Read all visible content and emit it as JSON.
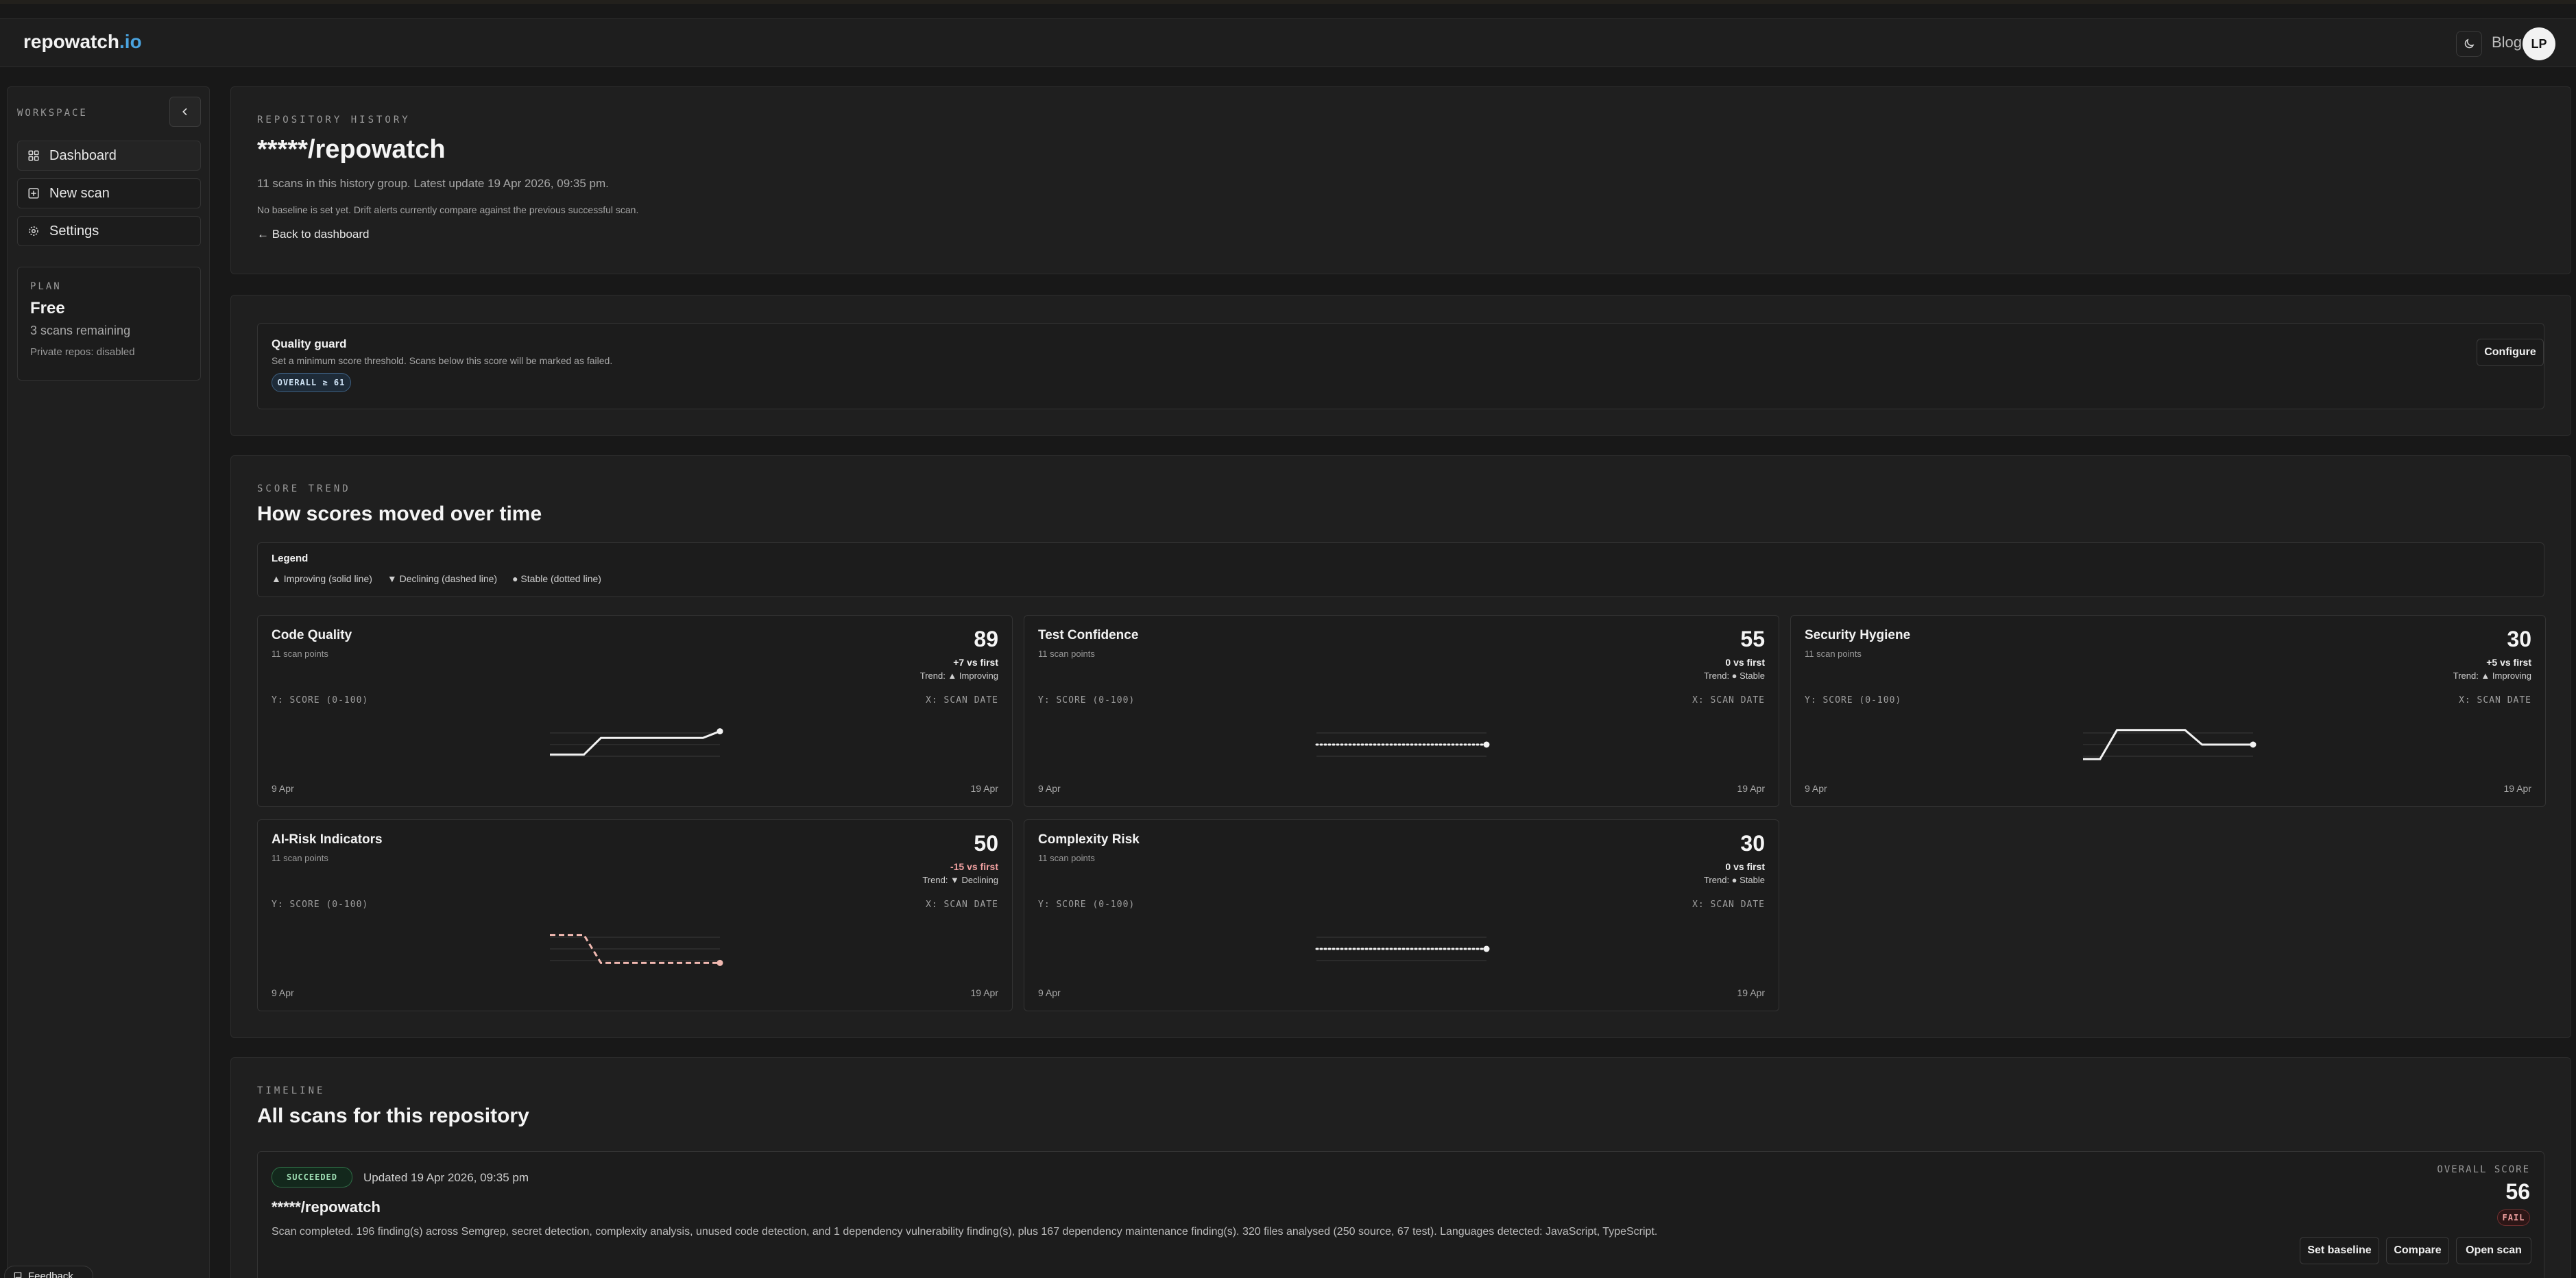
{
  "app": {
    "logo_main": "repowatch",
    "logo_tld": ".io"
  },
  "topbar": {
    "blog_label": "Blog",
    "avatar_initials": "LP"
  },
  "sidebar": {
    "section_label": "WORKSPACE",
    "items": [
      {
        "label": "Dashboard",
        "icon": "grid-icon",
        "active": true
      },
      {
        "label": "New scan",
        "icon": "plus-square-icon",
        "active": false
      },
      {
        "label": "Settings",
        "icon": "gear-icon",
        "active": false
      }
    ],
    "plan": {
      "label": "PLAN",
      "name": "Free",
      "remaining": "3 scans remaining",
      "private": "Private repos: disabled"
    }
  },
  "header": {
    "eyebrow": "REPOSITORY HISTORY",
    "title": "*****/repowatch",
    "summary": "11 scans in this history group. Latest update 19 Apr 2026, 09:35 pm.",
    "baseline_note": "No baseline is set yet. Drift alerts currently compare against the previous successful scan.",
    "back_link": "← Back to dashboard"
  },
  "quality_guard": {
    "title": "Quality guard",
    "description": "Set a minimum score threshold. Scans below this score will be marked as failed.",
    "badge": "OVERALL ≥ 61",
    "configure_label": "Configure"
  },
  "score_trend": {
    "eyebrow": "SCORE TREND",
    "title": "How scores moved over time",
    "legend_title": "Legend",
    "legend_improving": "▲ Improving (solid line)",
    "legend_declining": "▼ Declining (dashed line)",
    "legend_stable": "● Stable (dotted line)",
    "axis_y": "Y: SCORE (0-100)",
    "axis_x": "X: SCAN DATE",
    "date_start": "9 Apr",
    "date_end": "19 Apr"
  },
  "chart_data": [
    {
      "type": "line",
      "title": "Code Quality",
      "subtitle": "11 scan points",
      "score": "89",
      "delta": "+7 vs first",
      "trend": "Trend: ▲ Improving",
      "style": "solid",
      "color": "#f2f2f2",
      "x": [
        "9 Apr",
        "",
        "",
        "",
        "",
        "",
        "",
        "",
        "",
        "",
        "19 Apr"
      ],
      "values": [
        82,
        82,
        82,
        87,
        87,
        87,
        87,
        87,
        87,
        87,
        89
      ],
      "ylim": [
        78,
        92
      ]
    },
    {
      "type": "line",
      "title": "Test Confidence",
      "subtitle": "11 scan points",
      "score": "55",
      "delta": "0 vs first",
      "trend": "Trend: ● Stable",
      "style": "dotted",
      "color": "#f2f2f2",
      "x": [
        "9 Apr",
        "",
        "",
        "",
        "",
        "",
        "",
        "",
        "",
        "",
        "19 Apr"
      ],
      "values": [
        55,
        55,
        55,
        55,
        55,
        55,
        55,
        55,
        55,
        55,
        55
      ],
      "ylim": [
        45,
        65
      ]
    },
    {
      "type": "line",
      "title": "Security Hygiene",
      "subtitle": "11 scan points",
      "score": "30",
      "delta": "+5 vs first",
      "trend": "Trend: ▲ Improving",
      "style": "solid",
      "color": "#f2f2f2",
      "x": [
        "9 Apr",
        "",
        "",
        "",
        "",
        "",
        "",
        "",
        "",
        "",
        "19 Apr"
      ],
      "values": [
        25,
        25,
        35,
        35,
        35,
        35,
        35,
        30,
        30,
        30,
        30
      ],
      "ylim": [
        22,
        38
      ]
    },
    {
      "type": "line",
      "title": "AI-Risk Indicators",
      "subtitle": "11 scan points",
      "score": "50",
      "delta": "-15 vs first",
      "trend": "Trend: ▼ Declining",
      "style": "dashed",
      "color": "#f0b8b0",
      "x": [
        "9 Apr",
        "",
        "",
        "",
        "",
        "",
        "",
        "",
        "",
        "",
        "19 Apr"
      ],
      "values": [
        65,
        65,
        65,
        50,
        50,
        50,
        50,
        50,
        50,
        50,
        50
      ],
      "ylim": [
        45,
        70
      ]
    },
    {
      "type": "line",
      "title": "Complexity Risk",
      "subtitle": "11 scan points",
      "score": "30",
      "delta": "0 vs first",
      "trend": "Trend: ● Stable",
      "style": "dotted",
      "color": "#f2f2f2",
      "x": [
        "9 Apr",
        "",
        "",
        "",
        "",
        "",
        "",
        "",
        "",
        "",
        "19 Apr"
      ],
      "values": [
        30,
        30,
        30,
        30,
        30,
        30,
        30,
        30,
        30,
        30,
        30
      ],
      "ylim": [
        20,
        40
      ]
    }
  ],
  "timeline": {
    "eyebrow": "TIMELINE",
    "title": "All scans for this repository",
    "scan": {
      "status": "SUCCEEDED",
      "updated": "Updated 19 Apr 2026, 09:35 pm",
      "repo": "*****/repowatch",
      "description": "Scan completed. 196 finding(s) across Semgrep, secret detection, complexity analysis, unused code detection, and 1 dependency vulnerability finding(s), plus 167 dependency maintenance finding(s). 320 files analysed (250 source, 67 test). Languages detected: JavaScript, TypeScript.",
      "overall_label": "OVERALL SCORE",
      "overall_score": "56",
      "result_badge": "FAIL",
      "actions": {
        "set_baseline": "Set baseline",
        "compare": "Compare",
        "open_scan": "Open scan"
      }
    }
  },
  "feedback_label": "Feedback"
}
